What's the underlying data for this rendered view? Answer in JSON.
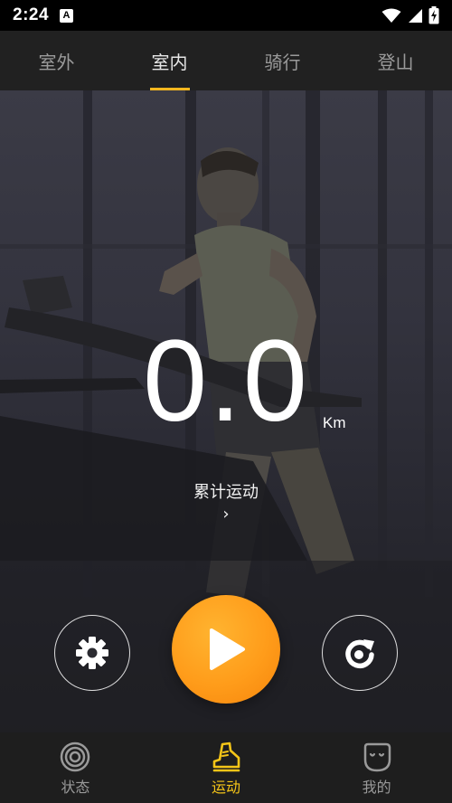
{
  "status_bar": {
    "time": "2:24",
    "notification_icon": "A"
  },
  "top_tabs": [
    {
      "label": "室外",
      "active": false
    },
    {
      "label": "室内",
      "active": true
    },
    {
      "label": "骑行",
      "active": false
    },
    {
      "label": "登山",
      "active": false
    }
  ],
  "workout": {
    "distance": "0.0",
    "unit": "Km",
    "cumulative_label": "累计运动",
    "chevron": "›"
  },
  "controls": {
    "settings_icon": "gear-icon",
    "play_icon": "play-icon",
    "refresh_icon": "refresh-icon"
  },
  "bottom_nav": [
    {
      "label": "状态",
      "icon": "target-icon",
      "active": false
    },
    {
      "label": "运动",
      "icon": "running-shoe-icon",
      "active": true
    },
    {
      "label": "我的",
      "icon": "face-icon",
      "active": false
    }
  ],
  "colors": {
    "accent": "#f5c518",
    "play_button": "#ff9c1a",
    "tab_underline": "#f5b71f"
  }
}
